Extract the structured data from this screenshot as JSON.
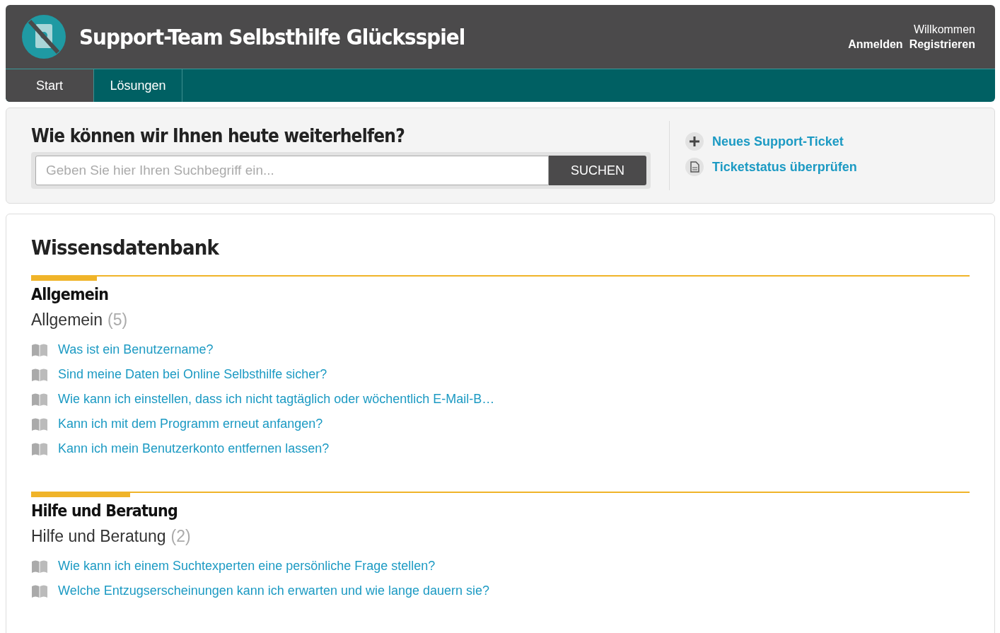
{
  "header": {
    "title": "Support-Team Selbsthilfe Glücksspiel",
    "welcome": "Willkommen",
    "links": [
      "Anmelden",
      "Registrieren"
    ]
  },
  "nav": [
    {
      "label": "Start",
      "selected": true
    },
    {
      "label": "Lösungen",
      "selected": false
    }
  ],
  "search": {
    "heading": "Wie können wir Ihnen heute weiterhelfen?",
    "placeholder": "Geben Sie hier Ihren Suchbegriff ein...",
    "button": "SUCHEN"
  },
  "actions": [
    {
      "kind": "plus",
      "label": "Neues Support-Ticket"
    },
    {
      "kind": "document",
      "label": "Ticketstatus überprüfen"
    }
  ],
  "knowledge_base": {
    "title": "Wissensdatenbank",
    "categories": [
      {
        "title": "Allgemein",
        "folder": "Allgemein",
        "count": "(5)",
        "articles": [
          "Was ist ein Benutzername?",
          "Sind meine Daten bei Online Selbsthilfe sicher?",
          "Wie kann ich einstellen, dass ich nicht tagtäglich oder wöchentlich E-Mail-B…",
          "Kann ich mit dem Programm erneut anfangen?",
          "Kann ich mein Benutzerkonto entfernen lassen?"
        ]
      },
      {
        "title": "Hilfe und Beratung",
        "folder": "Hilfe und Beratung",
        "count": "(2)",
        "articles": [
          "Wie kann ich einem Suchtexperten eine persönliche Frage stellen?",
          "Welche Entzugserscheinungen kann ich erwarten und wie lange dauern sie?"
        ]
      }
    ]
  }
}
